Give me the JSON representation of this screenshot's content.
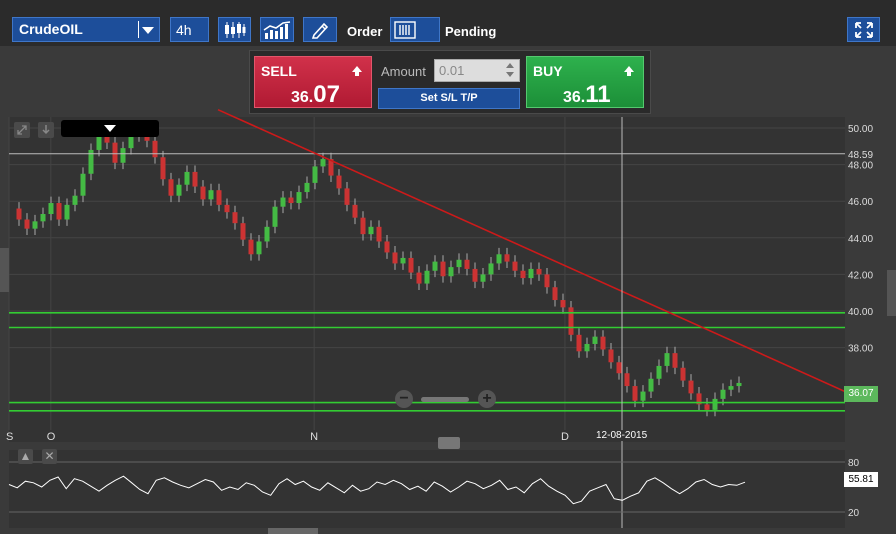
{
  "toolbar": {
    "symbol": "CrudeOIL",
    "timeframe": "4h",
    "order_label": "Order",
    "pending_label": "Pending"
  },
  "trade": {
    "sell_label": "SELL",
    "sell_price_main": "36.",
    "sell_price_big": "07",
    "buy_label": "BUY",
    "buy_price_main": "36.",
    "buy_price_big": "11",
    "amount_label": "Amount",
    "amount_value": "0.01",
    "setsl_label": "Set S/L T/P"
  },
  "chart": {
    "current_price": "36.07",
    "rsi_value": "55.81",
    "crosshair_date": "12-08-2015",
    "price_levels": [
      "50.00",
      "48.59",
      "48.00",
      "46.00",
      "44.00",
      "42.00",
      "40.00",
      "38.00"
    ],
    "x_labels": [
      "S",
      "O",
      "N",
      "D"
    ],
    "rsi_levels": [
      "80",
      "20"
    ],
    "colors": {
      "trendline": "#cc1a1a",
      "support": "#33cc33",
      "bull": "#44bb44",
      "bear": "#cc3333",
      "accent": "#1d4e9a"
    }
  },
  "chart_data": {
    "type": "candlestick",
    "title": "",
    "ylim": [
      33.5,
      50.6
    ],
    "y_ticks": [
      50,
      48,
      46,
      44,
      42,
      40,
      38
    ],
    "x_ticks": [
      "S",
      "O",
      "N",
      "D"
    ],
    "hlines": [
      48.59,
      39.9,
      39.1,
      35.0,
      34.55
    ],
    "trendline": [
      [
        0.25,
        51.0
      ],
      [
        0.95,
        36.2
      ]
    ],
    "close_series": [
      45.6,
      45.0,
      44.5,
      44.9,
      45.3,
      45.9,
      45.0,
      45.8,
      46.3,
      47.5,
      48.8,
      49.7,
      49.2,
      48.1,
      48.9,
      49.6,
      49.9,
      49.3,
      48.4,
      47.2,
      46.3,
      46.9,
      47.6,
      46.8,
      46.1,
      46.6,
      45.8,
      45.4,
      44.8,
      43.9,
      43.1,
      43.8,
      44.6,
      45.7,
      46.2,
      45.9,
      46.5,
      47.0,
      47.9,
      48.3,
      47.4,
      46.7,
      45.8,
      45.1,
      44.2,
      44.6,
      43.8,
      43.2,
      42.6,
      42.9,
      42.1,
      41.5,
      42.2,
      42.7,
      41.9,
      42.4,
      42.8,
      42.3,
      41.6,
      42.0,
      42.6,
      43.1,
      42.7,
      42.2,
      41.8,
      42.3,
      42.0,
      41.3,
      40.6,
      40.2,
      38.7,
      37.8,
      38.2,
      38.6,
      37.9,
      37.2,
      36.6,
      35.9,
      35.1,
      35.6,
      36.3,
      37.0,
      37.7,
      36.9,
      36.2,
      35.5,
      34.9,
      34.6,
      35.2,
      35.7,
      35.9,
      36.07
    ],
    "rsi": {
      "ylim": [
        20,
        80
      ],
      "current": 55.81,
      "values": [
        53,
        49,
        57,
        55,
        50,
        58,
        62,
        48,
        60,
        57,
        51,
        45,
        52,
        58,
        63,
        55,
        47,
        42,
        58,
        61,
        56,
        52,
        49,
        54,
        59,
        56,
        46,
        50,
        47,
        55,
        52,
        44,
        40,
        54,
        60,
        53,
        57,
        50,
        46,
        55,
        49,
        43,
        52,
        45,
        48,
        56,
        53,
        58,
        54,
        47,
        51,
        45,
        56,
        51,
        44,
        50,
        57,
        54,
        48,
        52,
        58,
        47,
        50,
        43,
        54,
        60,
        51,
        45,
        40,
        30,
        33,
        45,
        49,
        53,
        36,
        34,
        39,
        43,
        57,
        61,
        55,
        48,
        42,
        48,
        56,
        59,
        53,
        50,
        53,
        52,
        55.81
      ]
    }
  }
}
